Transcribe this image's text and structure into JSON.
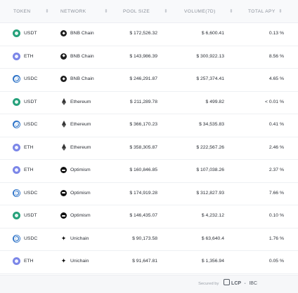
{
  "columns": {
    "token": "TOKEN",
    "network": "NETWORK",
    "pool_size": "POOL SIZE",
    "volume": "VOLUME(7D)",
    "apy": "TOTAL APY",
    "sort_glyph": "⬍"
  },
  "rows": [
    {
      "token": "USDT",
      "token_icon": "usdt",
      "network": "BNB Chain",
      "network_icon": "bnb",
      "pool": "$ 172,526.32",
      "volume": "$ 6,600.41",
      "apy": "0.13 %"
    },
    {
      "token": "ETH",
      "token_icon": "eth",
      "network": "BNB Chain",
      "network_icon": "bnb",
      "pool": "$ 143,986.39",
      "volume": "$ 300,922.13",
      "apy": "8.56 %"
    },
    {
      "token": "USDC",
      "token_icon": "usdc",
      "network": "BNB Chain",
      "network_icon": "bnb",
      "pool": "$ 246,291.87",
      "volume": "$ 257,374.41",
      "apy": "4.65 %"
    },
    {
      "token": "USDT",
      "token_icon": "usdt",
      "network": "Ethereum",
      "network_icon": "eth",
      "pool": "$ 211,289.78",
      "volume": "$ 499.82",
      "apy": "< 0.01 %"
    },
    {
      "token": "USDC",
      "token_icon": "usdc",
      "network": "Ethereum",
      "network_icon": "eth",
      "pool": "$ 366,170.23",
      "volume": "$ 34,535.83",
      "apy": "0.41 %"
    },
    {
      "token": "ETH",
      "token_icon": "eth",
      "network": "Ethereum",
      "network_icon": "eth",
      "pool": "$ 358,305.87",
      "volume": "$ 222,567.26",
      "apy": "2.46 %"
    },
    {
      "token": "ETH",
      "token_icon": "eth",
      "network": "Optimism",
      "network_icon": "op",
      "pool": "$ 160,846.85",
      "volume": "$ 107,038.26",
      "apy": "2.37 %"
    },
    {
      "token": "USDC",
      "token_icon": "usdc",
      "network": "Optimism",
      "network_icon": "op",
      "pool": "$ 174,919.28",
      "volume": "$ 312,827.93",
      "apy": "7.66 %"
    },
    {
      "token": "USDT",
      "token_icon": "usdt",
      "network": "Optimism",
      "network_icon": "op",
      "pool": "$ 146,435.07",
      "volume": "$ 4,232.12",
      "apy": "0.10 %"
    },
    {
      "token": "USDC",
      "token_icon": "usdc",
      "network": "Unichain",
      "network_icon": "uni",
      "pool": "$ 90,173.58",
      "volume": "$ 63,640.4",
      "apy": "1.76 %"
    },
    {
      "token": "ETH",
      "token_icon": "eth",
      "network": "Unichain",
      "network_icon": "uni",
      "pool": "$ 91,647.81",
      "volume": "$ 1,356.94",
      "apy": "0.05 %"
    }
  ],
  "footer": {
    "secured_by": "Secured by",
    "lcp": "LCP",
    "sep": "•",
    "ibc": "IBC"
  }
}
